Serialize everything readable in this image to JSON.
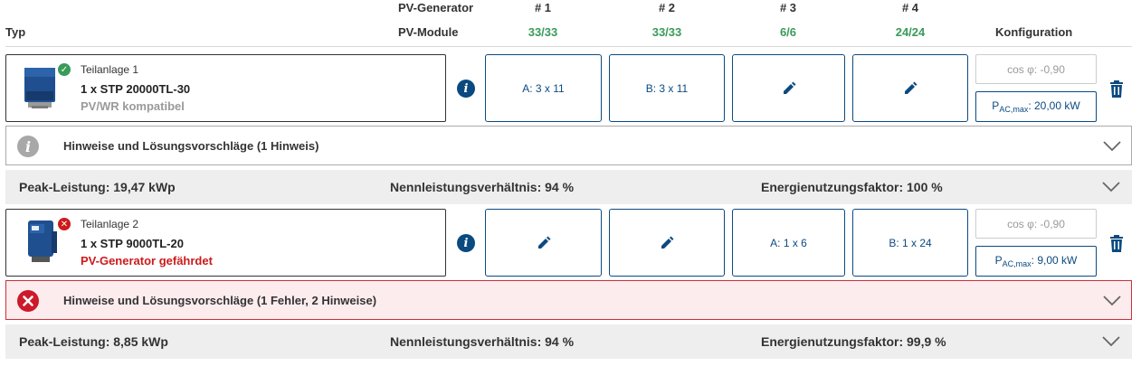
{
  "header": {
    "typ": "Typ",
    "pv_generator": "PV-Generator",
    "pv_module": "PV-Module",
    "konfiguration": "Konfiguration",
    "generators": [
      {
        "label": "# 1",
        "modules": "33/33"
      },
      {
        "label": "# 2",
        "modules": "33/33"
      },
      {
        "label": "# 3",
        "modules": "6/6"
      },
      {
        "label": "# 4",
        "modules": "24/24"
      }
    ]
  },
  "units": [
    {
      "subtitle": "Teilanlage 1",
      "name": "1 x STP 20000TL-30",
      "status": "PV/WR kompatibel",
      "status_type": "ok",
      "generators": [
        {
          "type": "text",
          "text": "A: 3 x 11"
        },
        {
          "type": "text",
          "text": "B: 3 x 11"
        },
        {
          "type": "edit",
          "icon": "pencil-icon"
        },
        {
          "type": "edit",
          "icon": "pencil-icon"
        }
      ],
      "cos_phi": "cos φ: -0,90",
      "pac_prefix": "P",
      "pac_sub": "AC,max",
      "pac_value": ": 20,00 kW",
      "hint": "Hinweise und Lösungsvorschläge (1 Hinweis)",
      "hint_type": "info",
      "summary": {
        "peak": "Peak-Leistung: 19,47 kWp",
        "ratio": "Nennleistungsverhältnis: 94 %",
        "factor": "Energienutzungsfaktor: 100 %"
      }
    },
    {
      "subtitle": "Teilanlage 2",
      "name": "1 x STP 9000TL-20",
      "status": "PV-Generator gefährdet",
      "status_type": "error",
      "generators": [
        {
          "type": "edit",
          "icon": "pencil-icon"
        },
        {
          "type": "edit",
          "icon": "pencil-icon"
        },
        {
          "type": "text",
          "text": "A: 1 x 6"
        },
        {
          "type": "text",
          "text": "B: 1 x 24"
        }
      ],
      "cos_phi": "cos φ: -0,90",
      "pac_prefix": "P",
      "pac_sub": "AC,max",
      "pac_value": ": 9,00 kW",
      "hint": "Hinweise und Lösungsvorschläge (1 Fehler, 2 Hinweise)",
      "hint_type": "error",
      "summary": {
        "peak": "Peak-Leistung: 8,85 kWp",
        "ratio": "Nennleistungsverhältnis: 94 %",
        "factor": "Energienutzungsfaktor: 99,9 %"
      }
    }
  ],
  "colors": {
    "accent": "#0b4a80",
    "ok": "#3a9a5a",
    "error": "#cc1a1a",
    "summary_bg": "#eeeeee"
  }
}
